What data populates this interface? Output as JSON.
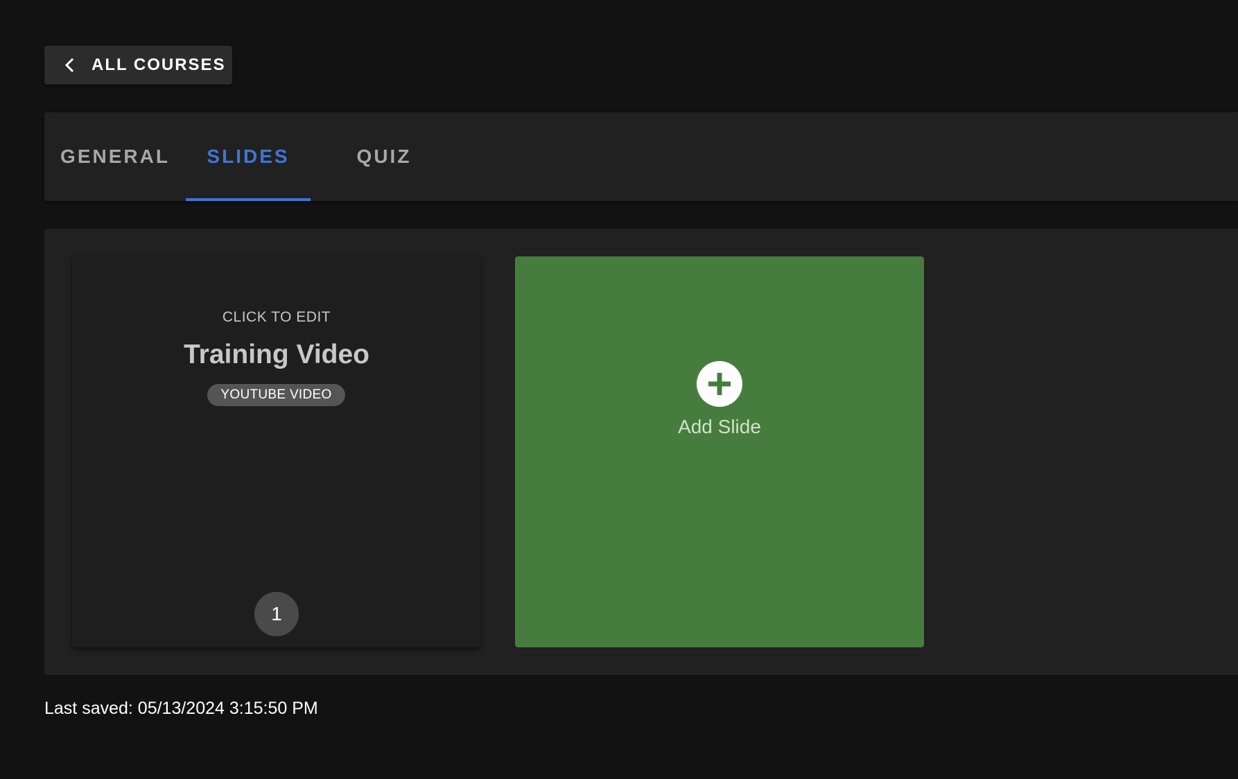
{
  "back_button": {
    "label": "ALL COURSES",
    "icon": "chevron-left-icon"
  },
  "tabs": [
    {
      "label": "GENERAL",
      "active": false
    },
    {
      "label": "SLIDES",
      "active": true
    },
    {
      "label": "QUIZ",
      "active": false
    }
  ],
  "colors": {
    "background": "#121212",
    "surface": "#212121",
    "accent": "#3f76d4",
    "add_slide": "#467d3e"
  },
  "slides": [
    {
      "hint": "CLICK TO EDIT",
      "title": "Training Video",
      "type": "YOUTUBE VIDEO",
      "number": "1"
    }
  ],
  "add_slide": {
    "label": "Add Slide",
    "icon": "plus-circle-icon"
  },
  "footer": {
    "last_saved": "Last saved: 05/13/2024 3:15:50 PM"
  }
}
